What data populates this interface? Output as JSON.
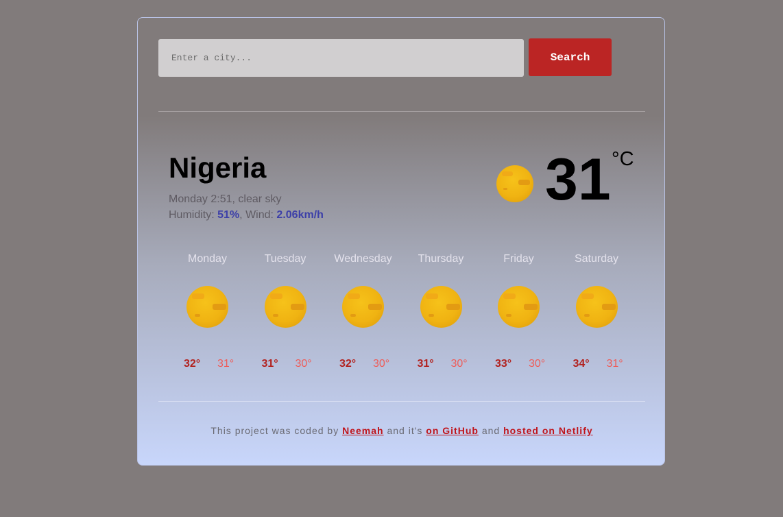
{
  "search": {
    "placeholder": "Enter a city...",
    "button_label": "Search"
  },
  "current": {
    "city": "Nigeria",
    "day_time": "Monday 2:51",
    "description": "clear sky",
    "humidity_label": "Humidity:",
    "humidity": "51%",
    "wind_label": "Wind:",
    "wind": "2.06km/h",
    "temperature": "31",
    "unit": "°C",
    "icon": "sun-icon"
  },
  "forecast": [
    {
      "day": "Monday",
      "max": "32°",
      "min": "31°",
      "icon": "sun-icon"
    },
    {
      "day": "Tuesday",
      "max": "31°",
      "min": "30°",
      "icon": "sun-icon"
    },
    {
      "day": "Wednesday",
      "max": "32°",
      "min": "30°",
      "icon": "sun-icon"
    },
    {
      "day": "Thursday",
      "max": "31°",
      "min": "30°",
      "icon": "sun-icon"
    },
    {
      "day": "Friday",
      "max": "33°",
      "min": "30°",
      "icon": "sun-icon"
    },
    {
      "day": "Saturday",
      "max": "34°",
      "min": "31°",
      "icon": "sun-icon"
    }
  ],
  "footer": {
    "text_1": "This project was coded by ",
    "author_link": "Neemah",
    "text_2": " and it's ",
    "github_link": "on GitHub",
    "text_3": " and ",
    "netlify_link": "hosted on Netlify"
  },
  "colors": {
    "page_bg": "#817b7b",
    "search_button": "#bb2524",
    "accent_value": "#3c3fa8",
    "max_temp": "#b2221f",
    "min_temp": "#ee5c58"
  }
}
